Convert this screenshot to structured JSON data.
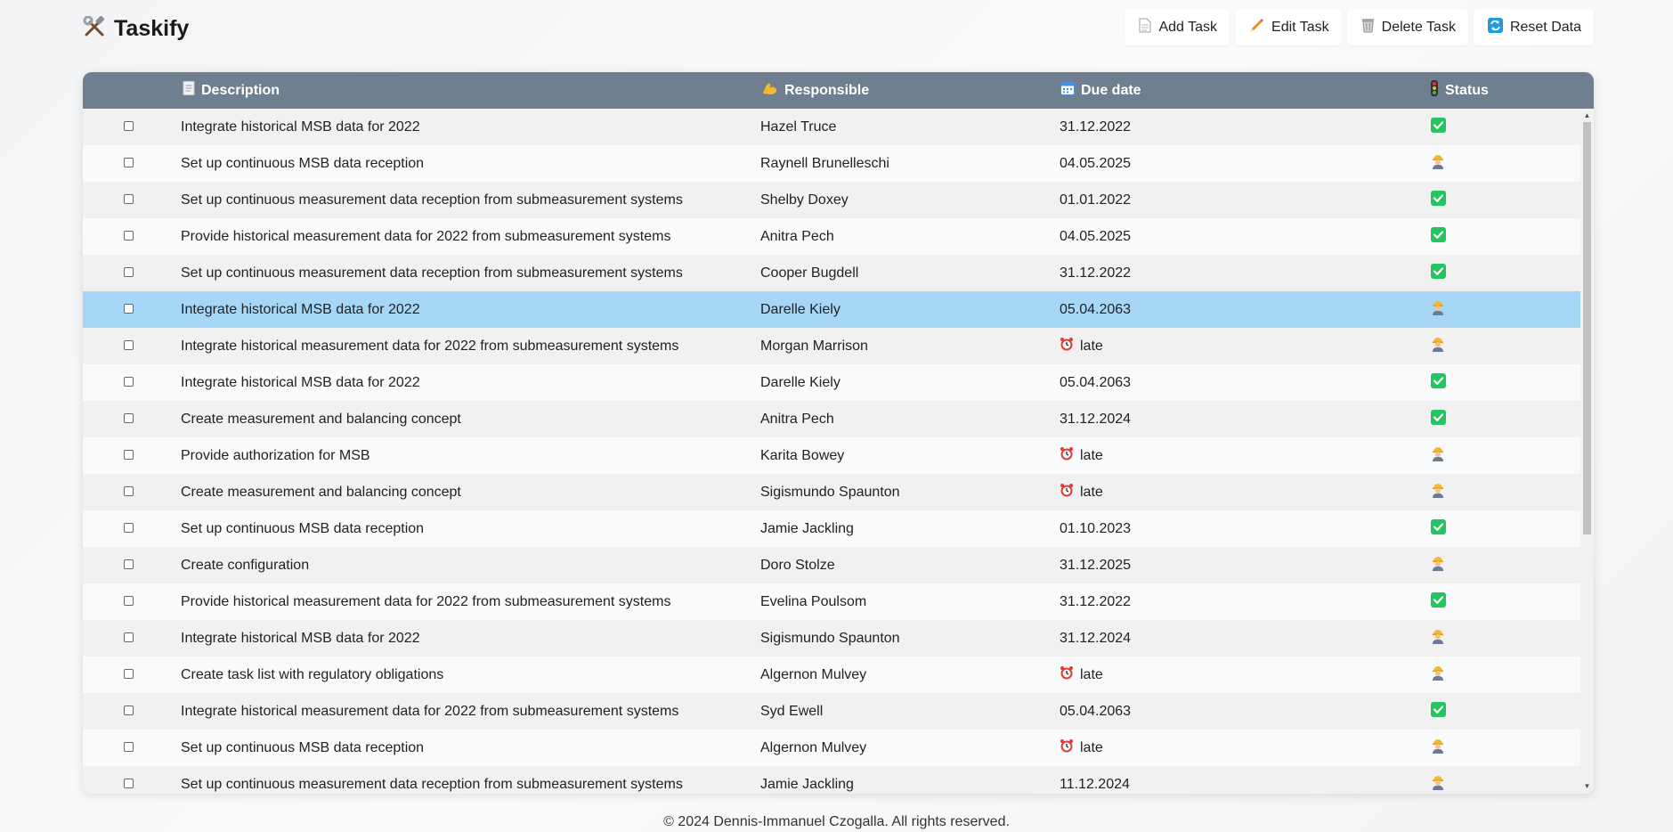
{
  "app": {
    "title": "Taskify"
  },
  "toolbar": {
    "add": "Add Task",
    "edit": "Edit Task",
    "delete": "Delete Task",
    "reset": "Reset Data"
  },
  "table": {
    "headers": {
      "description": "Description",
      "responsible": "Responsible",
      "due": "Due date",
      "status": "Status"
    },
    "late_label": "late",
    "rows": [
      {
        "description": "Integrate historical MSB data for 2022",
        "responsible": "Hazel Truce",
        "due": "31.12.2022",
        "late": false,
        "status": "done"
      },
      {
        "description": "Set up continuous MSB data reception",
        "responsible": "Raynell Brunelleschi",
        "due": "04.05.2025",
        "late": false,
        "status": "in-progress"
      },
      {
        "description": "Set up continuous measurement data reception from submeasurement systems",
        "responsible": "Shelby Doxey",
        "due": "01.01.2022",
        "late": false,
        "status": "done"
      },
      {
        "description": "Provide historical measurement data for 2022 from submeasurement systems",
        "responsible": "Anitra Pech",
        "due": "04.05.2025",
        "late": false,
        "status": "done"
      },
      {
        "description": "Set up continuous measurement data reception from submeasurement systems",
        "responsible": "Cooper Bugdell",
        "due": "31.12.2022",
        "late": false,
        "status": "done"
      },
      {
        "description": "Integrate historical MSB data for 2022",
        "responsible": "Darelle Kiely",
        "due": "05.04.2063",
        "late": false,
        "status": "in-progress",
        "selected": true
      },
      {
        "description": "Integrate historical measurement data for 2022 from submeasurement systems",
        "responsible": "Morgan Marrison",
        "due": "",
        "late": true,
        "status": "in-progress"
      },
      {
        "description": "Integrate historical MSB data for 2022",
        "responsible": "Darelle Kiely",
        "due": "05.04.2063",
        "late": false,
        "status": "done"
      },
      {
        "description": "Create measurement and balancing concept",
        "responsible": "Anitra Pech",
        "due": "31.12.2024",
        "late": false,
        "status": "done"
      },
      {
        "description": "Provide authorization for MSB",
        "responsible": "Karita Bowey",
        "due": "",
        "late": true,
        "status": "in-progress"
      },
      {
        "description": "Create measurement and balancing concept",
        "responsible": "Sigismundo Spaunton",
        "due": "",
        "late": true,
        "status": "in-progress"
      },
      {
        "description": "Set up continuous MSB data reception",
        "responsible": "Jamie Jackling",
        "due": "01.10.2023",
        "late": false,
        "status": "done"
      },
      {
        "description": "Create configuration",
        "responsible": "Doro Stolze",
        "due": "31.12.2025",
        "late": false,
        "status": "in-progress"
      },
      {
        "description": "Provide historical measurement data for 2022 from submeasurement systems",
        "responsible": "Evelina Poulsom",
        "due": "31.12.2022",
        "late": false,
        "status": "done"
      },
      {
        "description": "Integrate historical MSB data for 2022",
        "responsible": "Sigismundo Spaunton",
        "due": "31.12.2024",
        "late": false,
        "status": "in-progress"
      },
      {
        "description": "Create task list with regulatory obligations",
        "responsible": "Algernon Mulvey",
        "due": "",
        "late": true,
        "status": "in-progress"
      },
      {
        "description": "Integrate historical measurement data for 2022 from submeasurement systems",
        "responsible": "Syd Ewell",
        "due": "05.04.2063",
        "late": false,
        "status": "done"
      },
      {
        "description": "Set up continuous MSB data reception",
        "responsible": "Algernon Mulvey",
        "due": "",
        "late": true,
        "status": "in-progress"
      },
      {
        "description": "Set up continuous measurement data reception from submeasurement systems",
        "responsible": "Jamie Jackling",
        "due": "11.12.2024",
        "late": false,
        "status": "in-progress"
      }
    ]
  },
  "footer": {
    "text": "© 2024 Dennis-Immanuel Czogalla. All rights reserved."
  },
  "colors": {
    "header_bg": "#6f7f90",
    "selected_row": "#a6d7f7",
    "done_green": "#22c55e",
    "late_red": "#e53935"
  }
}
